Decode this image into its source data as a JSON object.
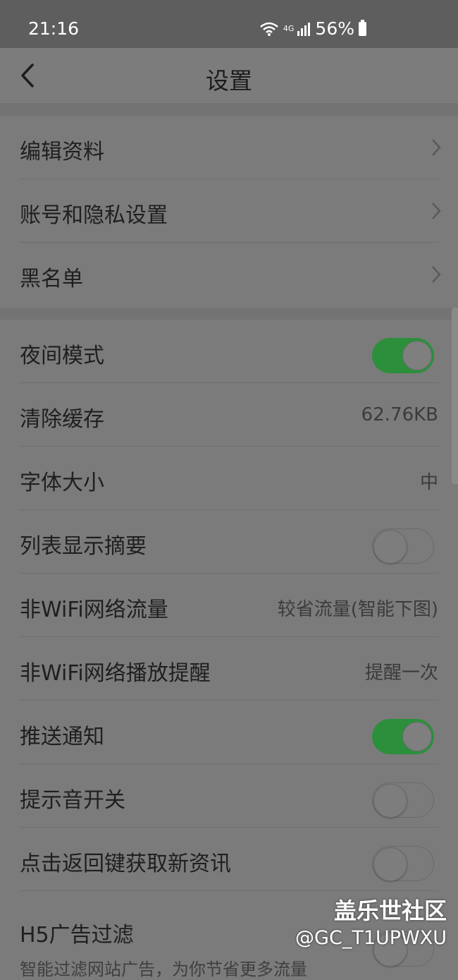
{
  "status_bar": {
    "time": "21:16",
    "network": "4G",
    "battery": "56%"
  },
  "nav": {
    "title": "设置"
  },
  "group1": [
    {
      "label": "编辑资料"
    },
    {
      "label": "账号和隐私设置"
    },
    {
      "label": "黑名单"
    }
  ],
  "group2": [
    {
      "label": "夜间模式",
      "toggle": true
    },
    {
      "label": "清除缓存",
      "value": "62.76KB"
    },
    {
      "label": "字体大小",
      "value": "中"
    },
    {
      "label": "列表显示摘要",
      "toggle": false
    },
    {
      "label": "非WiFi网络流量",
      "value": "较省流量(智能下图)"
    },
    {
      "label": "非WiFi网络播放提醒",
      "value": "提醒一次"
    },
    {
      "label": "推送通知",
      "toggle": true
    },
    {
      "label": "提示音开关",
      "toggle": false
    },
    {
      "label": "点击返回键获取新资讯",
      "toggle": false
    },
    {
      "label": "H5广告过滤",
      "sublabel": "智能过滤网站广告，为你节省更多流量",
      "toggle": false
    }
  ],
  "watermark": {
    "line1": "盖乐世社区",
    "line2": "@GC_T1UPWXU"
  },
  "colors": {
    "toggle_on": "#2c8f3c",
    "overlay": "#7b7b7b"
  }
}
